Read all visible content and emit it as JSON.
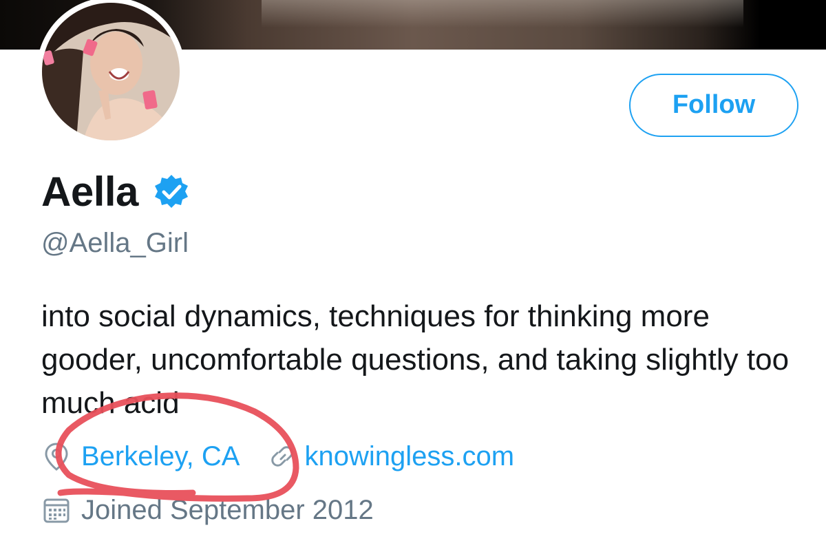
{
  "profile": {
    "name": "Aella",
    "handle": "@Aella_Girl",
    "verified": true,
    "bio": "into social dynamics, techniques for thinking more gooder, uncomfortable questions, and taking slightly too much acid",
    "location": "Berkeley, CA",
    "website": "knowingless.com",
    "joined": "Joined September 2012"
  },
  "actions": {
    "follow_label": "Follow"
  },
  "icons": {
    "verified": "verified-badge-icon",
    "location": "location-pin-icon",
    "link": "link-icon",
    "calendar": "calendar-icon"
  },
  "colors": {
    "accent": "#1da1f2",
    "secondary_text": "#657786",
    "primary_text": "#14171a",
    "annotation": "#e8505b"
  }
}
